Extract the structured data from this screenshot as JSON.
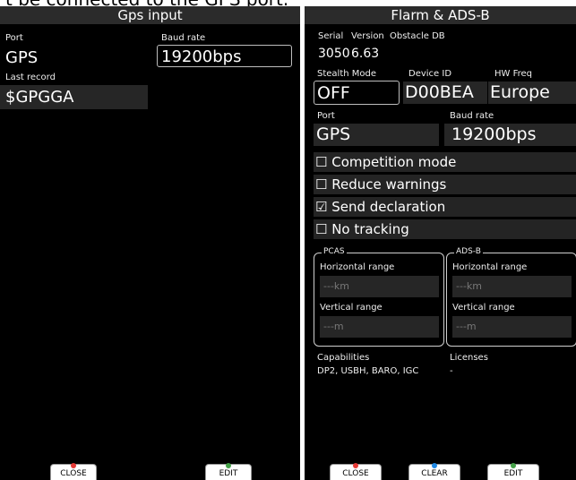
{
  "top_caption": "t be connected to the GPS port.",
  "gps_panel": {
    "title": "Gps input",
    "port_label": "Port",
    "port_value": "GPS",
    "baud_label": "Baud rate",
    "baud_value": "19200bps",
    "last_record_label": "Last record",
    "last_record_value": "$GPGGA",
    "buttons": {
      "close": "CLOSE",
      "edit": "EDIT"
    }
  },
  "flarm_panel": {
    "title": "Flarm & ADS-B",
    "serial_label": "Serial",
    "serial_value": "3050",
    "version_label": "Version",
    "version_value": "6.63",
    "obstacle_label": "Obstacle DB",
    "stealth_label": "Stealth Mode",
    "stealth_value": "OFF",
    "device_id_label": "Device ID",
    "device_id_value": "D00BEA",
    "hw_freq_label": "HW Freq",
    "hw_freq_value": "Europe",
    "port_label": "Port",
    "port_value": "GPS",
    "baud_label": "Baud rate",
    "baud_value": "19200bps",
    "checkboxes": [
      {
        "label": "☐ Competition mode",
        "checked": false
      },
      {
        "label": "☐ Reduce warnings",
        "checked": false
      },
      {
        "label": "☑ Send declaration",
        "checked": true
      },
      {
        "label": "☐ No tracking",
        "checked": false
      }
    ],
    "pcas": {
      "title": "PCAS",
      "h_range_label": "Horizontal range",
      "h_range_value": "---km",
      "v_range_label": "Vertical range",
      "v_range_value": "---m"
    },
    "adsb": {
      "title": "ADS-B",
      "h_range_label": "Horizontal range",
      "h_range_value": "---km",
      "v_range_label": "Vertical range",
      "v_range_value": "---m"
    },
    "capabilities_label": "Capabilities",
    "capabilities_value": "DP2, USBH, BARO, IGC",
    "licenses_label": "Licenses",
    "licenses_value": "-",
    "buttons": {
      "close": "CLOSE",
      "clear": "CLEAR",
      "edit": "EDIT"
    }
  },
  "colors": {
    "close": "#e53935",
    "clear": "#1e88e5",
    "edit": "#43a047"
  }
}
